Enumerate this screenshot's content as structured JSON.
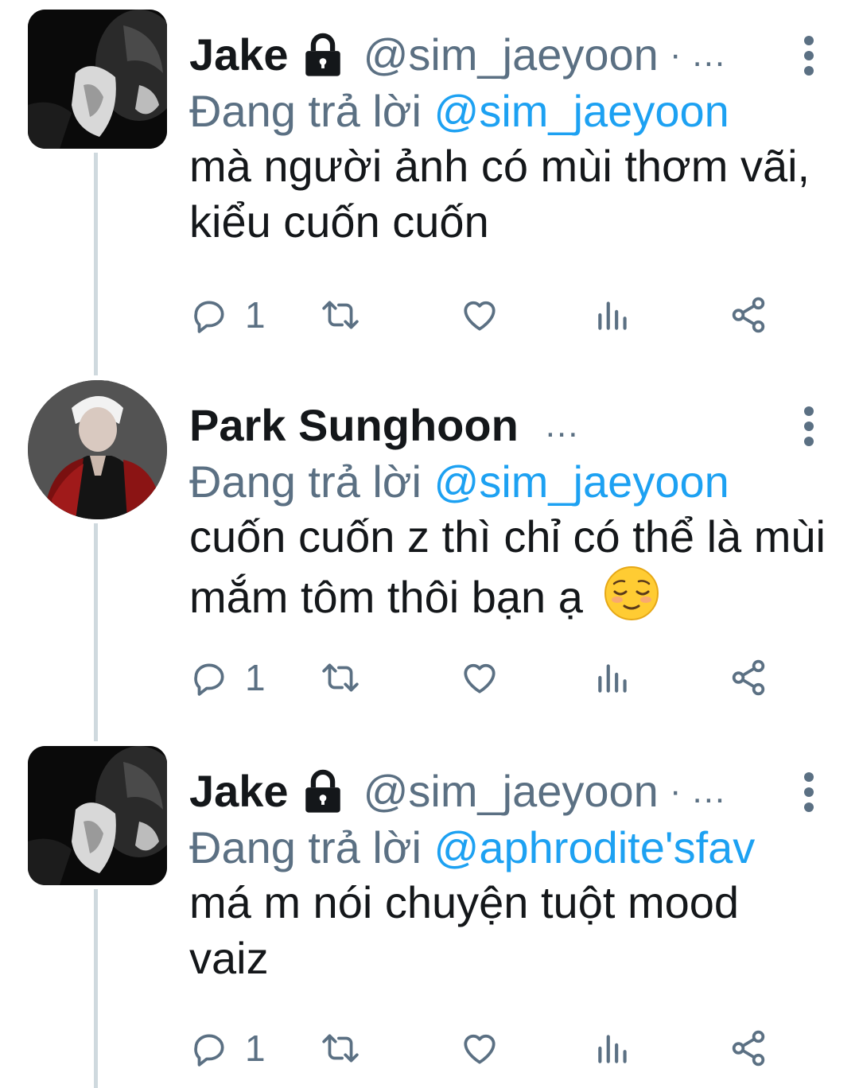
{
  "tweets": [
    {
      "name": "Jake",
      "locked": true,
      "handle": "@sim_jaeyoon",
      "separator": "·",
      "overflow": "...",
      "reply_prefix": "Đang trả lời",
      "reply_to": "@sim_jaeyoon",
      "text": "mà người ảnh có mùi thơm vãi, kiểu cuốn cuốn",
      "reply_count": "1"
    },
    {
      "name": "Park Sunghoon",
      "locked": false,
      "overflow": "...",
      "reply_prefix": "Đang trả lời",
      "reply_to": "@sim_jaeyoon",
      "text": "cuốn cuốn z thì chỉ có thể là mùi mắm tôm thôi bạn ạ",
      "emoji": "relieved-face",
      "reply_count": "1"
    },
    {
      "name": "Jake",
      "locked": true,
      "handle": "@sim_jaeyoon",
      "separator": "·",
      "overflow": "...",
      "reply_prefix": "Đang trả lời",
      "reply_to": "@aphrodite'sfav",
      "text": "má m nói chuyện tuột mood vaiz",
      "reply_count": "1"
    }
  ],
  "icons": {
    "reply": "reply-icon",
    "retweet": "retweet-icon",
    "like": "heart-icon",
    "analytics": "analytics-icon",
    "share": "share-icon",
    "more": "more-vertical-icon",
    "lock": "lock-icon"
  },
  "colors": {
    "text": "#14171a",
    "secondary": "#5b7083",
    "mention": "#1da1f2",
    "thread_line": "#cfd9de",
    "background": "#ffffff"
  }
}
